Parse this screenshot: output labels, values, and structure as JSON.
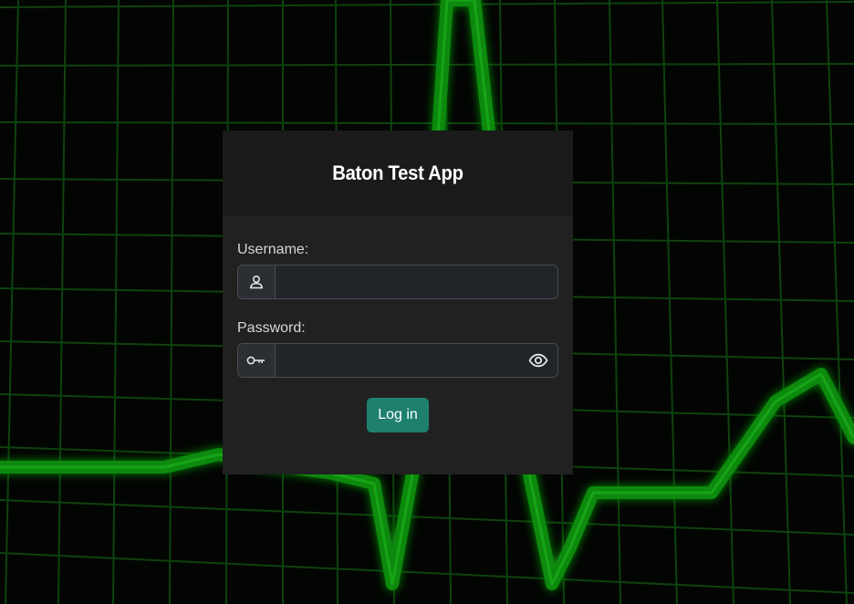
{
  "app": {
    "title": "Baton Test App"
  },
  "form": {
    "username_label": "Username:",
    "username_value": "",
    "password_label": "Password:",
    "password_value": "",
    "login_label": "Log in"
  },
  "icons": {
    "username": "user-icon",
    "password": "key-icon",
    "show_password": "eye-icon"
  },
  "colors": {
    "background": "#030503",
    "grid": "#0f4a0f",
    "heartbeat": "#0c8a0c",
    "card": "#212121",
    "card_header": "#1b1b1b",
    "primary": "#1f8070"
  }
}
